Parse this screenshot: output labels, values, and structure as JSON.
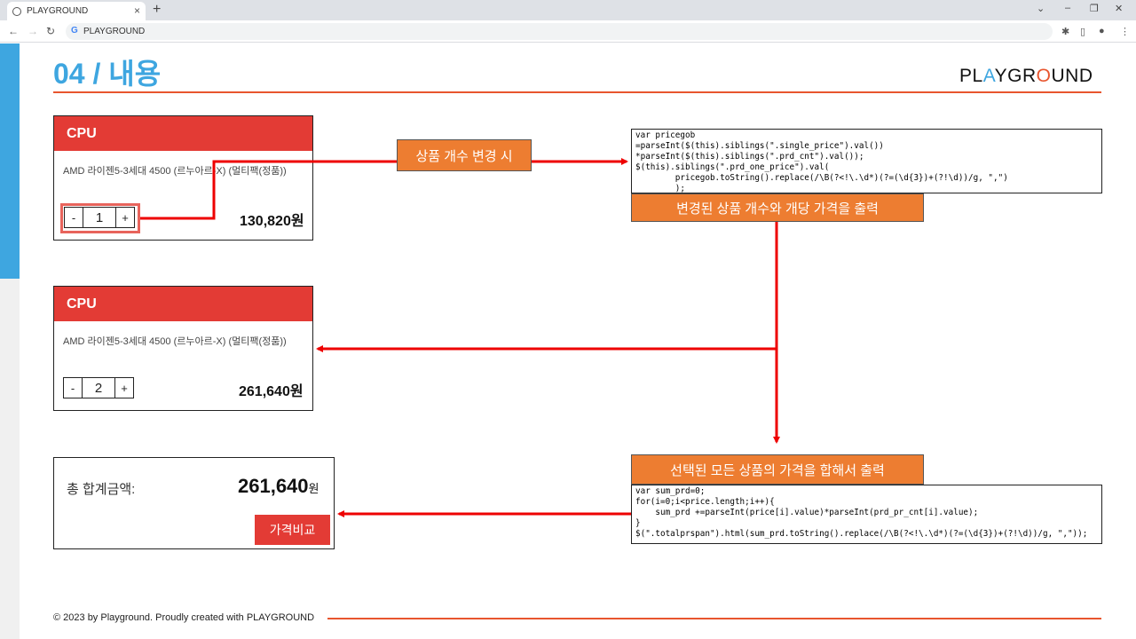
{
  "browser": {
    "tab_title": "PLAYGROUND",
    "tab_close": "×",
    "new_tab": "+",
    "url": "PLAYGROUND",
    "window_controls": [
      "⌄",
      "–",
      "❐",
      "✕"
    ]
  },
  "page": {
    "title": "04 / 내용",
    "brand": {
      "p1": "PL",
      "a": "A",
      "p2": "YGR",
      "o": "O",
      "p3": "UND"
    }
  },
  "card1": {
    "header": "CPU",
    "desc": "AMD 라이젠5-3세대 4500 (르누아르-X) (멀티팩(정품))",
    "minus": "-",
    "qty": "1",
    "plus": "+",
    "price": "130,820원"
  },
  "card2": {
    "header": "CPU",
    "desc": "AMD 라이젠5-3세대 4500 (르누아르-X) (멀티팩(정품))",
    "minus": "-",
    "qty": "2",
    "plus": "+",
    "price": "261,640원"
  },
  "total": {
    "label": "총 합계금액:",
    "value": "261,640",
    "unit": "원",
    "compare_button": "가격비교"
  },
  "labels": {
    "on_change": "상품 개수 변경 시",
    "output_each": "변경된 상품 개수와 개당 가격을 출력",
    "output_sum": "선택된 모든 상품의 가격을 합해서 출력"
  },
  "code1": [
    "var pricegob",
    "=parseInt($(this).siblings(\".single_price\").val())",
    "*parseInt($(this).siblings(\".prd_cnt\").val());",
    "$(this).siblings(\".prd_one_price\").val(",
    "        pricegob.toString().replace(/\\B(?<!\\.\\d*)(?=(\\d{3})+(?!\\d))/g, \",\")",
    "        );"
  ],
  "code2": [
    "var sum_prd=0;",
    "for(i=0;i<price.length;i++){",
    "    sum_prd +=parseInt(price[i].value)*parseInt(prd_pr_cnt[i].value);",
    "}",
    "$(\".totalprspan\").html(sum_prd.toString().replace(/\\B(?<!\\.\\d*)(?=(\\d{3})+(?!\\d))/g, \",\"));"
  ],
  "footer": "© 2023 by Playground. Proudly created with PLAYGROUND",
  "colors": {
    "accent_blue": "#3ea6e0",
    "accent_orange": "#e8552e",
    "card_red": "#e33b35",
    "label_orange": "#ed7d31",
    "arrow_red": "#ee0000"
  }
}
